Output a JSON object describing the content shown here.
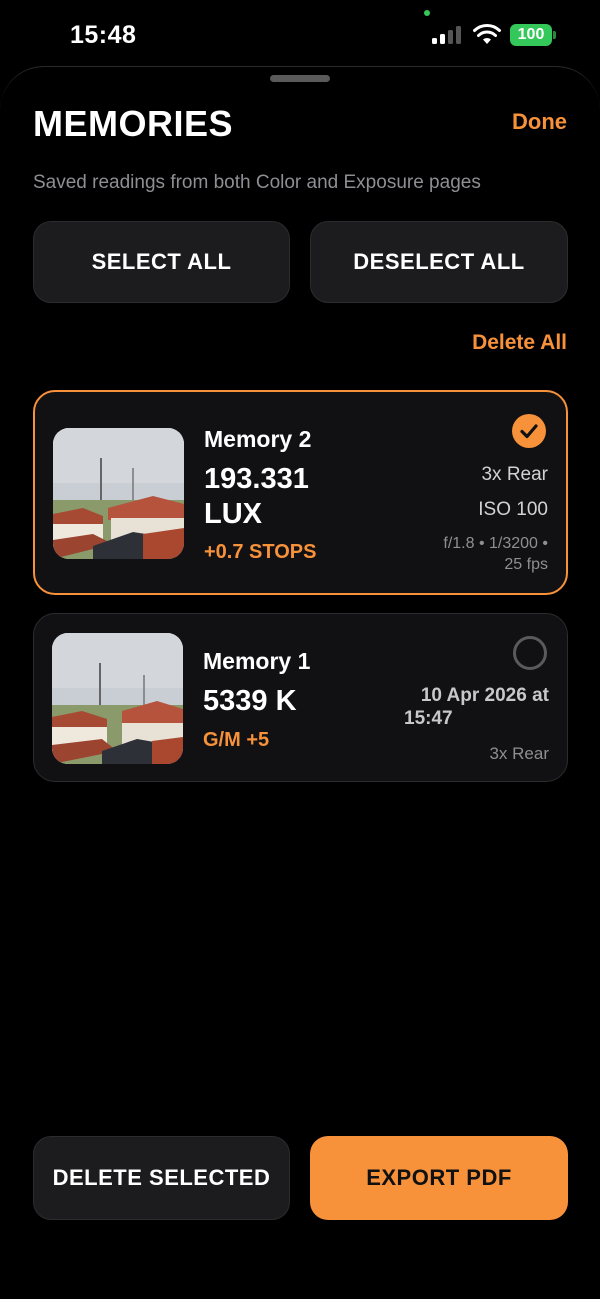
{
  "status_bar": {
    "time": "15:48",
    "battery": "100",
    "icons": [
      "signal-icon",
      "wifi-icon",
      "battery-icon"
    ]
  },
  "header": {
    "title": "MEMORIES",
    "done_label": "Done",
    "subtitle": "Saved readings from both Color and Exposure pages"
  },
  "actions": {
    "select_all": "SELECT ALL",
    "deselect_all": "DESELECT ALL",
    "delete_all": "Delete All"
  },
  "memories": [
    {
      "name": "Memory 2",
      "value_line1": "193.331",
      "value_line2": "LUX",
      "accent": "+0.7 STOPS",
      "camera": "3x Rear",
      "iso": "ISO 100",
      "exposure_line1": "f/1.8 • 1/3200 •",
      "exposure_line2": "25 fps",
      "selected": true
    },
    {
      "name": "Memory 1",
      "value_line1": "5339 K",
      "accent": "G/M +5",
      "date_line1": "10 Apr 2026 at",
      "date_line2": "15:47",
      "camera": "3x Rear",
      "selected": false
    }
  ],
  "footer": {
    "delete_selected": "DELETE SELECTED",
    "export_pdf": "EXPORT PDF"
  },
  "colors": {
    "accent": "#f7913a",
    "background": "#000000",
    "surface": "#1c1c1e",
    "battery": "#34c759"
  }
}
